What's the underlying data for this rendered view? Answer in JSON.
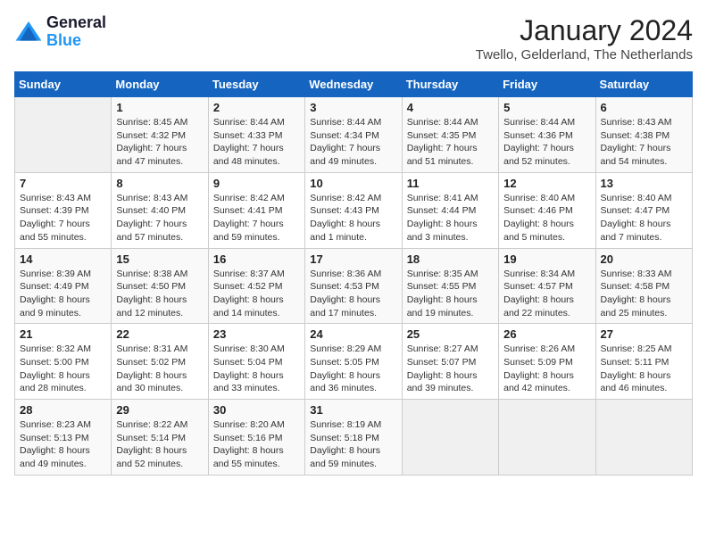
{
  "header": {
    "logo_line1": "General",
    "logo_line2": "Blue",
    "month": "January 2024",
    "location": "Twello, Gelderland, The Netherlands"
  },
  "weekdays": [
    "Sunday",
    "Monday",
    "Tuesday",
    "Wednesday",
    "Thursday",
    "Friday",
    "Saturday"
  ],
  "weeks": [
    [
      {
        "day": "",
        "info": ""
      },
      {
        "day": "1",
        "info": "Sunrise: 8:45 AM\nSunset: 4:32 PM\nDaylight: 7 hours\nand 47 minutes."
      },
      {
        "day": "2",
        "info": "Sunrise: 8:44 AM\nSunset: 4:33 PM\nDaylight: 7 hours\nand 48 minutes."
      },
      {
        "day": "3",
        "info": "Sunrise: 8:44 AM\nSunset: 4:34 PM\nDaylight: 7 hours\nand 49 minutes."
      },
      {
        "day": "4",
        "info": "Sunrise: 8:44 AM\nSunset: 4:35 PM\nDaylight: 7 hours\nand 51 minutes."
      },
      {
        "day": "5",
        "info": "Sunrise: 8:44 AM\nSunset: 4:36 PM\nDaylight: 7 hours\nand 52 minutes."
      },
      {
        "day": "6",
        "info": "Sunrise: 8:43 AM\nSunset: 4:38 PM\nDaylight: 7 hours\nand 54 minutes."
      }
    ],
    [
      {
        "day": "7",
        "info": "Sunrise: 8:43 AM\nSunset: 4:39 PM\nDaylight: 7 hours\nand 55 minutes."
      },
      {
        "day": "8",
        "info": "Sunrise: 8:43 AM\nSunset: 4:40 PM\nDaylight: 7 hours\nand 57 minutes."
      },
      {
        "day": "9",
        "info": "Sunrise: 8:42 AM\nSunset: 4:41 PM\nDaylight: 7 hours\nand 59 minutes."
      },
      {
        "day": "10",
        "info": "Sunrise: 8:42 AM\nSunset: 4:43 PM\nDaylight: 8 hours\nand 1 minute."
      },
      {
        "day": "11",
        "info": "Sunrise: 8:41 AM\nSunset: 4:44 PM\nDaylight: 8 hours\nand 3 minutes."
      },
      {
        "day": "12",
        "info": "Sunrise: 8:40 AM\nSunset: 4:46 PM\nDaylight: 8 hours\nand 5 minutes."
      },
      {
        "day": "13",
        "info": "Sunrise: 8:40 AM\nSunset: 4:47 PM\nDaylight: 8 hours\nand 7 minutes."
      }
    ],
    [
      {
        "day": "14",
        "info": "Sunrise: 8:39 AM\nSunset: 4:49 PM\nDaylight: 8 hours\nand 9 minutes."
      },
      {
        "day": "15",
        "info": "Sunrise: 8:38 AM\nSunset: 4:50 PM\nDaylight: 8 hours\nand 12 minutes."
      },
      {
        "day": "16",
        "info": "Sunrise: 8:37 AM\nSunset: 4:52 PM\nDaylight: 8 hours\nand 14 minutes."
      },
      {
        "day": "17",
        "info": "Sunrise: 8:36 AM\nSunset: 4:53 PM\nDaylight: 8 hours\nand 17 minutes."
      },
      {
        "day": "18",
        "info": "Sunrise: 8:35 AM\nSunset: 4:55 PM\nDaylight: 8 hours\nand 19 minutes."
      },
      {
        "day": "19",
        "info": "Sunrise: 8:34 AM\nSunset: 4:57 PM\nDaylight: 8 hours\nand 22 minutes."
      },
      {
        "day": "20",
        "info": "Sunrise: 8:33 AM\nSunset: 4:58 PM\nDaylight: 8 hours\nand 25 minutes."
      }
    ],
    [
      {
        "day": "21",
        "info": "Sunrise: 8:32 AM\nSunset: 5:00 PM\nDaylight: 8 hours\nand 28 minutes."
      },
      {
        "day": "22",
        "info": "Sunrise: 8:31 AM\nSunset: 5:02 PM\nDaylight: 8 hours\nand 30 minutes."
      },
      {
        "day": "23",
        "info": "Sunrise: 8:30 AM\nSunset: 5:04 PM\nDaylight: 8 hours\nand 33 minutes."
      },
      {
        "day": "24",
        "info": "Sunrise: 8:29 AM\nSunset: 5:05 PM\nDaylight: 8 hours\nand 36 minutes."
      },
      {
        "day": "25",
        "info": "Sunrise: 8:27 AM\nSunset: 5:07 PM\nDaylight: 8 hours\nand 39 minutes."
      },
      {
        "day": "26",
        "info": "Sunrise: 8:26 AM\nSunset: 5:09 PM\nDaylight: 8 hours\nand 42 minutes."
      },
      {
        "day": "27",
        "info": "Sunrise: 8:25 AM\nSunset: 5:11 PM\nDaylight: 8 hours\nand 46 minutes."
      }
    ],
    [
      {
        "day": "28",
        "info": "Sunrise: 8:23 AM\nSunset: 5:13 PM\nDaylight: 8 hours\nand 49 minutes."
      },
      {
        "day": "29",
        "info": "Sunrise: 8:22 AM\nSunset: 5:14 PM\nDaylight: 8 hours\nand 52 minutes."
      },
      {
        "day": "30",
        "info": "Sunrise: 8:20 AM\nSunset: 5:16 PM\nDaylight: 8 hours\nand 55 minutes."
      },
      {
        "day": "31",
        "info": "Sunrise: 8:19 AM\nSunset: 5:18 PM\nDaylight: 8 hours\nand 59 minutes."
      },
      {
        "day": "",
        "info": ""
      },
      {
        "day": "",
        "info": ""
      },
      {
        "day": "",
        "info": ""
      }
    ]
  ]
}
